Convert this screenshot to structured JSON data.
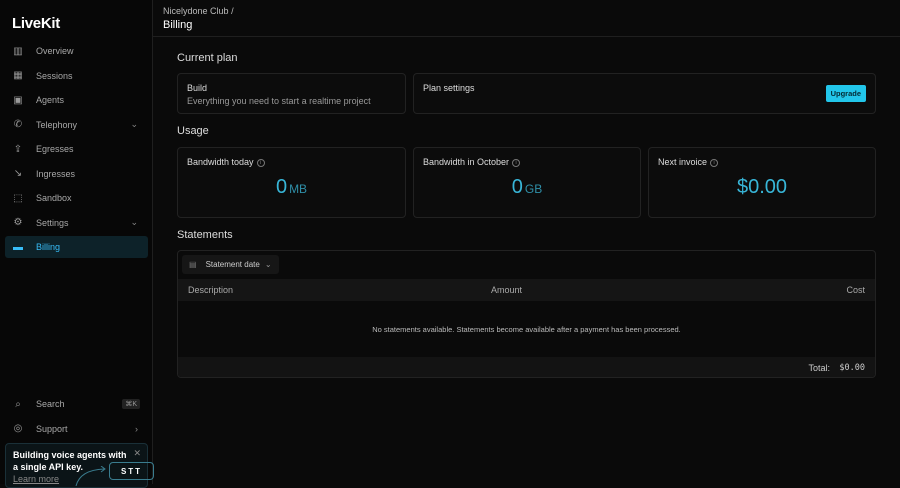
{
  "app": {
    "logo": "LiveKit"
  },
  "sidebar": {
    "items": [
      {
        "label": "Overview",
        "icon": "bar-chart-icon"
      },
      {
        "label": "Sessions",
        "icon": "grid-icon"
      },
      {
        "label": "Agents",
        "icon": "robot-icon"
      },
      {
        "label": "Telephony",
        "icon": "phone-icon",
        "expandable": true
      },
      {
        "label": "Egresses",
        "icon": "upload-icon"
      },
      {
        "label": "Ingresses",
        "icon": "ingress-icon"
      },
      {
        "label": "Sandbox",
        "icon": "dashed-square-icon"
      },
      {
        "label": "Settings",
        "icon": "gear-icon",
        "expandable": true
      },
      {
        "label": "Billing",
        "icon": "card-icon",
        "active": true
      }
    ],
    "search": {
      "label": "Search",
      "shortcut": "⌘K"
    },
    "support": {
      "label": "Support"
    },
    "promo": {
      "text": "Building voice agents with a single API key.",
      "link": "Learn more",
      "badge": "STT"
    }
  },
  "header": {
    "breadcrumb": "Nicelydone Club",
    "separator": "/",
    "title": "Billing"
  },
  "current_plan": {
    "heading": "Current plan",
    "plan_name": "Build",
    "plan_desc": "Everything you need to start a realtime project",
    "settings_title": "Plan settings",
    "upgrade": "Upgrade"
  },
  "usage": {
    "heading": "Usage",
    "cards": [
      {
        "title": "Bandwidth today",
        "value": "0",
        "unit": "MB"
      },
      {
        "title": "Bandwidth in October",
        "value": "0",
        "unit": "GB"
      },
      {
        "title": "Next invoice",
        "value": "$0.00",
        "unit": ""
      }
    ]
  },
  "statements": {
    "heading": "Statements",
    "filter": "Statement date",
    "columns": [
      "Description",
      "Amount",
      "Cost"
    ],
    "empty": "No statements available. Statements become available after a payment has been processed.",
    "total_label": "Total:",
    "total_value": "$0.00"
  },
  "colors": {
    "accent": "#38b6d8",
    "button": "#22c6ea"
  }
}
